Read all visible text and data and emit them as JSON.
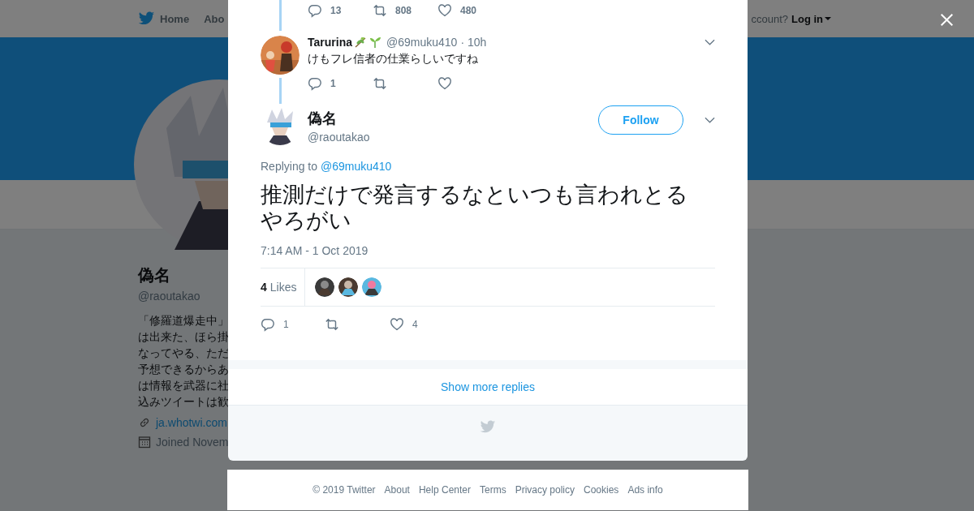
{
  "header": {
    "nav_items": [
      "Home",
      "Abo"
    ],
    "login_prompt": "ccount?",
    "login": "Log in"
  },
  "profile": {
    "name": "偽名",
    "handle": "@raoutakao",
    "bio_lines": [
      "「修羅道爆走中」",
      "は出来た、ほら掛",
      "なってやる、ただ",
      "予想できるからあ",
      "は情報を武器に社",
      "込みツイートは歓"
    ],
    "website": "ja.whotwi.com",
    "joined": "Joined Novem"
  },
  "dialog": {
    "previous_actions": {
      "replies": "13",
      "retweets": "808",
      "likes": "480"
    },
    "reply": {
      "name": "Tarurina",
      "handle": "@69muku410",
      "separator": "·",
      "time": "10h",
      "text": "けもフレ信者の仕業らしいですね",
      "replies": "1"
    },
    "tweet": {
      "name": "偽名",
      "handle": "@raoutakao",
      "follow": "Follow",
      "replying_label": "Replying to",
      "replying_to": "@69muku410",
      "text": "推測だけで発言するなといつも言われとるやろがい",
      "timestamp": "7:14 AM - 1 Oct 2019",
      "likes_count": "4",
      "likes_label": "Likes",
      "replies": "1",
      "likes": "4"
    },
    "show_more": "Show more replies"
  },
  "footer": [
    "© 2019 Twitter",
    "About",
    "Help Center",
    "Terms",
    "Privacy policy",
    "Cookies",
    "Ads info"
  ]
}
